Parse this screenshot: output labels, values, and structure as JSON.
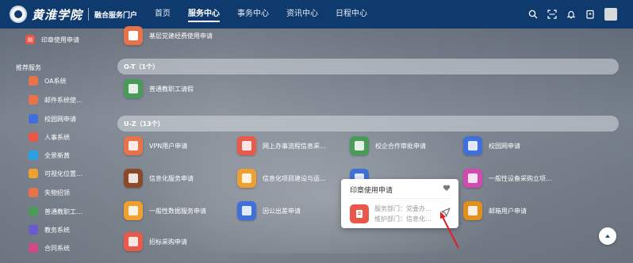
{
  "header": {
    "brand": "黄淮学院",
    "portal": "融合服务门户",
    "nav": [
      {
        "label": "首页"
      },
      {
        "label": "服务中心",
        "active": true
      },
      {
        "label": "事务中心"
      },
      {
        "label": "资讯中心"
      },
      {
        "label": "日程中心"
      }
    ],
    "icons": [
      "search-icon",
      "scan-icon",
      "bell-icon",
      "clipboard-icon",
      "avatar"
    ],
    "color": "#0f3a6e"
  },
  "sidebar": {
    "top_item": {
      "label": "印章使用申请",
      "color": "#e8574a"
    },
    "section_label": "推荐服务",
    "items": [
      {
        "label": "OA系统",
        "color": "#e8734a"
      },
      {
        "label": "邮件系统使...",
        "color": "#e8734a"
      },
      {
        "label": "校园网申请",
        "color": "#3f6fd8"
      },
      {
        "label": "人事系统",
        "color": "#e8574a"
      },
      {
        "label": "全景新黄",
        "color": "#2aa1e6"
      },
      {
        "label": "可视化位置...",
        "color": "#f0a030"
      },
      {
        "label": "失物招领",
        "color": "#e8734a"
      },
      {
        "label": "普通教职工...",
        "color": "#4a9a5a"
      },
      {
        "label": "教务系统",
        "color": "#6a5acd"
      },
      {
        "label": "合同系统",
        "color": "#d04a8a"
      }
    ]
  },
  "main": {
    "top_partial": {
      "label": "基层党建经费使用申请",
      "color": "#e8734a"
    },
    "groups": [
      {
        "title": "O-T（1个）",
        "apps": [
          {
            "label": "普通教职工请假",
            "color": "#4a9a5a"
          }
        ]
      },
      {
        "title": "U-Z（13个）",
        "apps": [
          {
            "label": "VPN用户申请",
            "color": "#e8734a"
          },
          {
            "label": "网上办事流程信息采...",
            "color": "#e85a4a"
          },
          {
            "label": "校企合作审批申请",
            "color": "#4a9a5a"
          },
          {
            "label": "校园网申请",
            "color": "#3f6fd8"
          },
          {
            "label": "信息化服务申请",
            "color": "#8a4a2a"
          },
          {
            "label": "信息化项目建设与运...",
            "color": "#f0a030"
          },
          {
            "label": "",
            "color": "#3f6fd8"
          },
          {
            "label": "一般性设备采购立项...",
            "color": "#d04ab0"
          },
          {
            "label": "一般性数据服务申请",
            "color": "#f0a030"
          },
          {
            "label": "因公出差申请",
            "color": "#3f6fd8"
          },
          {
            "label": "",
            "color": "#e8574a"
          },
          {
            "label": "邮箱用户申请",
            "color": "#e09020"
          },
          {
            "label": "招标采购申请",
            "color": "#e85a4a"
          }
        ]
      }
    ]
  },
  "popup": {
    "title": "印章使用申请",
    "dept_line": "服务部门：党委办...",
    "maint_line": "维护部门：信息化...",
    "icon_color": "#e8574a"
  }
}
